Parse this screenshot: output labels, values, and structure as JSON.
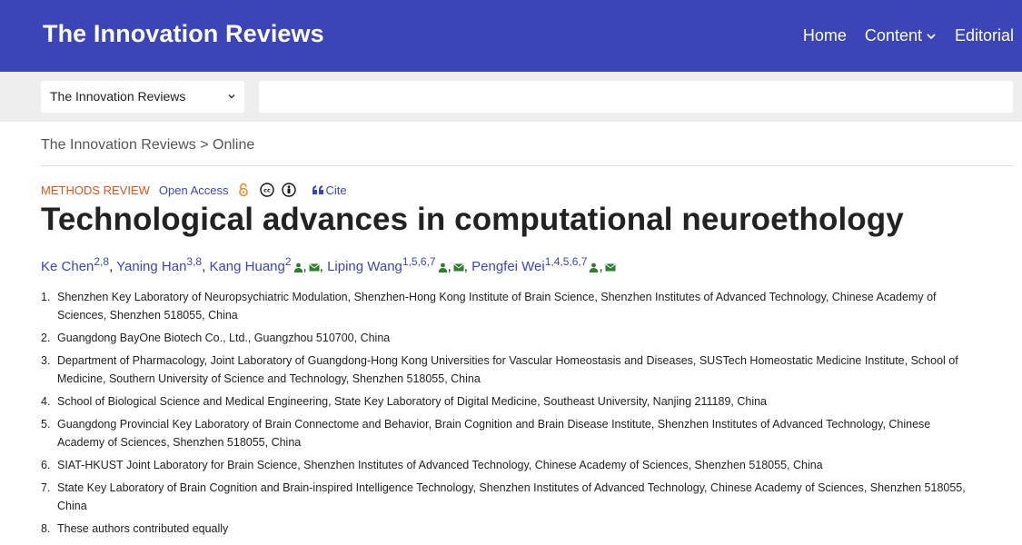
{
  "header": {
    "brand": "The Innovation Reviews",
    "nav": [
      {
        "label": "Home"
      },
      {
        "label": "Content",
        "has_dropdown": true
      },
      {
        "label": "Editorial"
      }
    ]
  },
  "search": {
    "scope_selected": "The Innovation Reviews",
    "query": "",
    "placeholder": ""
  },
  "breadcrumb": {
    "root": "The Innovation Reviews",
    "separator": " > ",
    "current": "Online"
  },
  "article": {
    "type": "METHODS REVIEW",
    "access": "Open Access",
    "cite_label": "Cite",
    "title": "Technological advances in computational neuroethology",
    "authors": [
      {
        "name": "Ke Chen",
        "sup": "2,8",
        "icons": []
      },
      {
        "name": "Yaning Han",
        "sup": "3,8",
        "icons": []
      },
      {
        "name": "Kang Huang",
        "sup": "2",
        "icons": [
          "person-icon",
          "email-icon"
        ]
      },
      {
        "name": "Liping Wang",
        "sup": "1,5,6,7",
        "icons": [
          "person-icon",
          "email-icon"
        ]
      },
      {
        "name": "Pengfei Wei",
        "sup": "1,4,5,6,7",
        "icons": [
          "person-icon",
          "email-icon"
        ]
      }
    ],
    "affiliations": [
      "Shenzhen Key Laboratory of Neuropsychiatric Modulation, Shenzhen-Hong Kong Institute of Brain Science, Shenzhen Institutes of Advanced Technology, Chinese Academy of Sciences, Shenzhen 518055, China",
      "Guangdong BayOne Biotech Co., Ltd., Guangzhou 510700, China",
      "Department of Pharmacology, Joint Laboratory of Guangdong-Hong Kong Universities for Vascular Homeostasis and Diseases, SUSTech Homeostatic Medicine Institute, School of Medicine, Southern University of Science and Technology, Shenzhen 518055, China",
      "School of Biological Science and Medical Engineering, State Key Laboratory of Digital Medicine, Southeast University, Nanjing 211189, China",
      "Guangdong Provincial Key Laboratory of Brain Connectome and Behavior, Brain Cognition and Brain Disease Institute, Shenzhen Institutes of Advanced Technology, Chinese Academy of Sciences, Shenzhen 518055, China",
      "SIAT-HKUST Joint Laboratory for Brain Science, Shenzhen Institutes of Advanced Technology, Chinese Academy of Sciences, Shenzhen 518055, China",
      "State Key Laboratory of Brain Cognition and Brain-inspired Intelligence Technology, Shenzhen Institutes of Advanced Technology, Chinese Academy of Sciences, Shenzhen 518055, China",
      "These authors contributed equally"
    ]
  },
  "colors": {
    "header_bg": "#3c45b8",
    "link": "#3c45b8",
    "article_type": "#d9571a",
    "open_access_icon": "#f08a24",
    "author_icons": "#2e7d32"
  }
}
